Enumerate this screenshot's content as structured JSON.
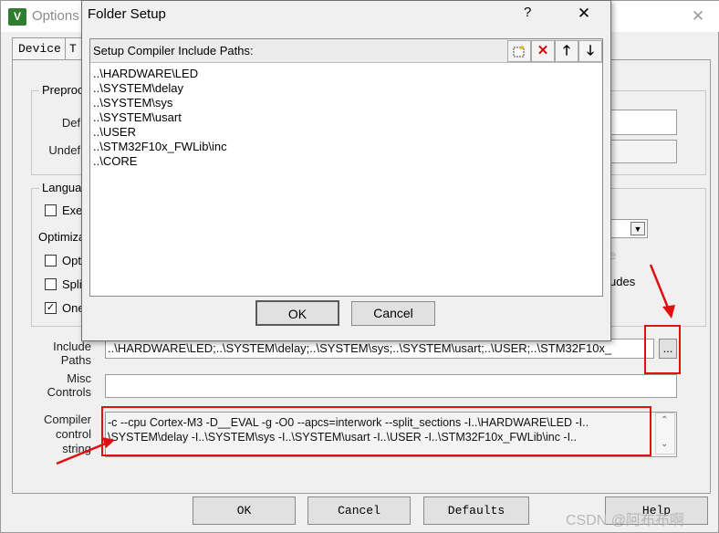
{
  "background_window": {
    "title": "Options",
    "close": "✕",
    "tabs": [
      "Device",
      "T"
    ],
    "preprocessor_group": "Preproc",
    "define_label": "Defi",
    "undefine_label": "Undefi",
    "language_group": "Langua",
    "exec_label": "Exe",
    "optimization_label": "Optimiza",
    "opt_label": "Opti",
    "split_label": "Spli",
    "one_label": "One",
    "partial_text": "udes",
    "include_paths_label": "Include\nPaths",
    "include_paths_value": "..\\HARDWARE\\LED;..\\SYSTEM\\delay;..\\SYSTEM\\sys;..\\SYSTEM\\usart;..\\USER;..\\STM32F10x_",
    "browse_button": "...",
    "misc_controls_label": "Misc\nControls",
    "compiler_control_label": "Compiler\ncontrol\nstring",
    "compiler_control_line1": "-c --cpu Cortex-M3 -D__EVAL -g -O0 --apcs=interwork --split_sections -I..\\HARDWARE\\LED -I..",
    "compiler_control_line2": "\\SYSTEM\\delay -I..\\SYSTEM\\sys -I..\\SYSTEM\\usart -I..\\USER -I..\\STM32F10x_FWLib\\inc -I..",
    "ok_button": "OK",
    "cancel_button": "Cancel",
    "defaults_button": "Defaults",
    "help_button": "Help"
  },
  "dialog": {
    "title": "Folder Setup",
    "help": "?",
    "close": "✕",
    "list_header": "Setup Compiler Include Paths:",
    "paths": [
      "..\\HARDWARE\\LED",
      "..\\SYSTEM\\delay",
      "..\\SYSTEM\\sys",
      "..\\SYSTEM\\usart",
      "..\\USER",
      "..\\STM32F10x_FWLib\\inc",
      "..\\CORE"
    ],
    "ok_button": "OK",
    "cancel_button": "Cancel"
  },
  "watermark": "CSDN @阿布布啊",
  "colors": {
    "annotation_red": "#e01010",
    "app_icon_green": "#2f7d2f"
  }
}
